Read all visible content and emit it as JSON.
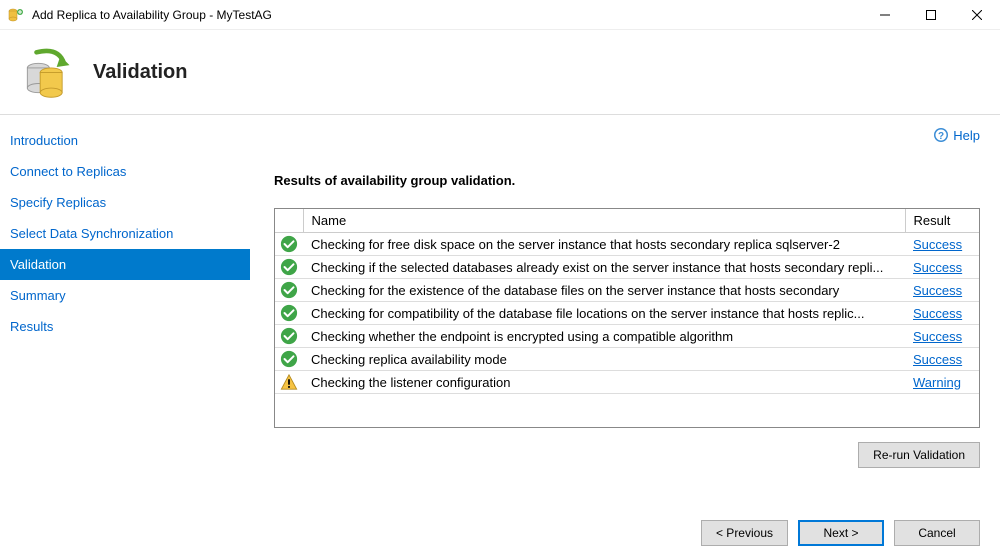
{
  "window": {
    "title": "Add Replica to Availability Group - MyTestAG"
  },
  "header": {
    "title": "Validation"
  },
  "sidebar": {
    "items": [
      {
        "label": "Introduction",
        "active": false
      },
      {
        "label": "Connect to Replicas",
        "active": false
      },
      {
        "label": "Specify Replicas",
        "active": false
      },
      {
        "label": "Select Data Synchronization",
        "active": false
      },
      {
        "label": "Validation",
        "active": true
      },
      {
        "label": "Summary",
        "active": false
      },
      {
        "label": "Results",
        "active": false
      }
    ]
  },
  "help": {
    "label": "Help"
  },
  "results": {
    "title": "Results of availability group validation.",
    "columns": {
      "name": "Name",
      "result": "Result"
    },
    "rows": [
      {
        "status": "success",
        "name": "Checking for free disk space on the server instance that hosts secondary replica sqlserver-2",
        "result": "Success"
      },
      {
        "status": "success",
        "name": "Checking if the selected databases already exist on the server instance that hosts secondary repli...",
        "result": "Success"
      },
      {
        "status": "success",
        "name": "Checking for the existence of the database files on the server instance that hosts secondary",
        "result": "Success"
      },
      {
        "status": "success",
        "name": "Checking for compatibility of the database file locations on the server instance that hosts replic...",
        "result": "Success"
      },
      {
        "status": "success",
        "name": "Checking whether the endpoint is encrypted using a compatible algorithm",
        "result": "Success"
      },
      {
        "status": "success",
        "name": "Checking replica availability mode",
        "result": "Success"
      },
      {
        "status": "warning",
        "name": "Checking the listener configuration",
        "result": "Warning"
      }
    ]
  },
  "buttons": {
    "rerun": "Re-run Validation",
    "previous": "< Previous",
    "next": "Next >",
    "cancel": "Cancel"
  }
}
